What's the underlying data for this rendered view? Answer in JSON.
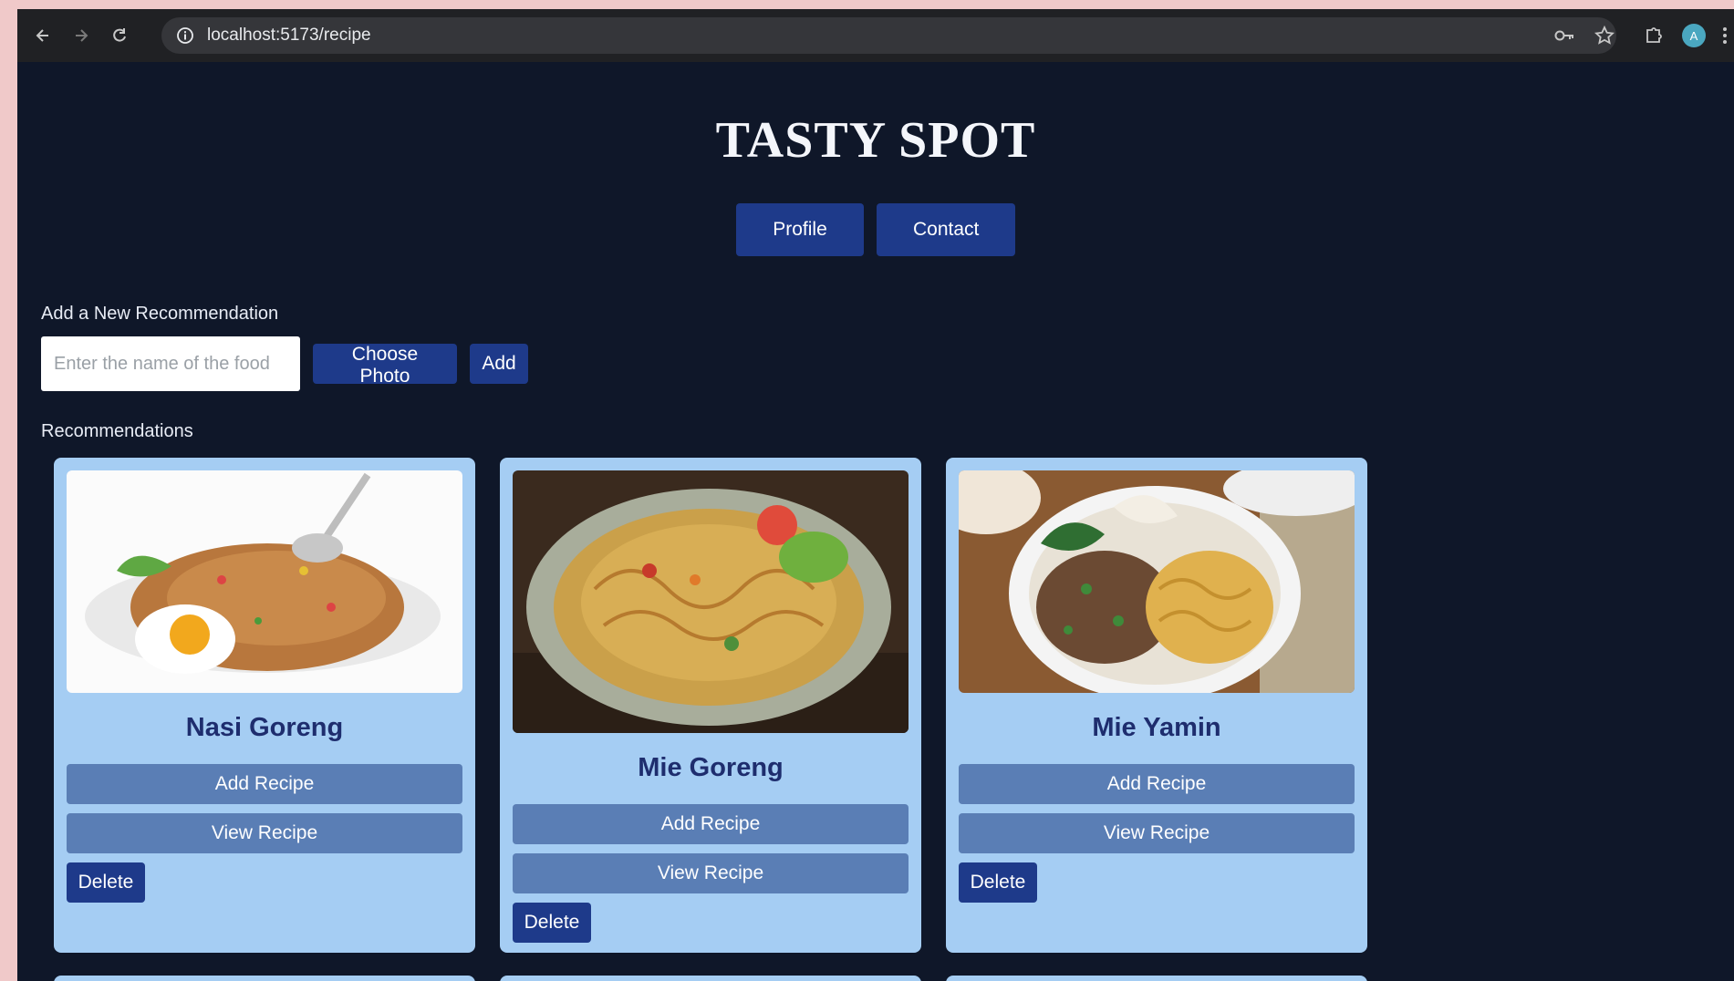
{
  "browser": {
    "url_host": "localhost",
    "url_path": ":5173/recipe",
    "profile_initial": "A"
  },
  "site": {
    "title": "TASTY SPOT"
  },
  "nav": {
    "profile": "Profile",
    "contact": "Contact"
  },
  "add_form": {
    "heading": "Add a New Recommendation",
    "placeholder": "Enter the name of the food",
    "choose_photo": "Choose Photo",
    "add": "Add"
  },
  "recommendations": {
    "heading": "Recommendations",
    "cards": [
      {
        "name": "Nasi Goreng",
        "add_recipe": "Add Recipe",
        "view_recipe": "View Recipe",
        "delete": "Delete",
        "image": "fried-rice-photo"
      },
      {
        "name": "Mie Goreng",
        "add_recipe": "Add Recipe",
        "view_recipe": "View Recipe",
        "delete": "Delete",
        "image": "fried-noodles-photo"
      },
      {
        "name": "Mie Yamin",
        "add_recipe": "Add Recipe",
        "view_recipe": "View Recipe",
        "delete": "Delete",
        "image": "noodle-bowl-photo"
      }
    ]
  },
  "colors": {
    "page_bg": "#0f1729",
    "primary_button": "#1e3a8a",
    "card_bg": "#a5cdf3",
    "card_button": "#5a7eb5",
    "card_title": "#1e2d6e"
  }
}
